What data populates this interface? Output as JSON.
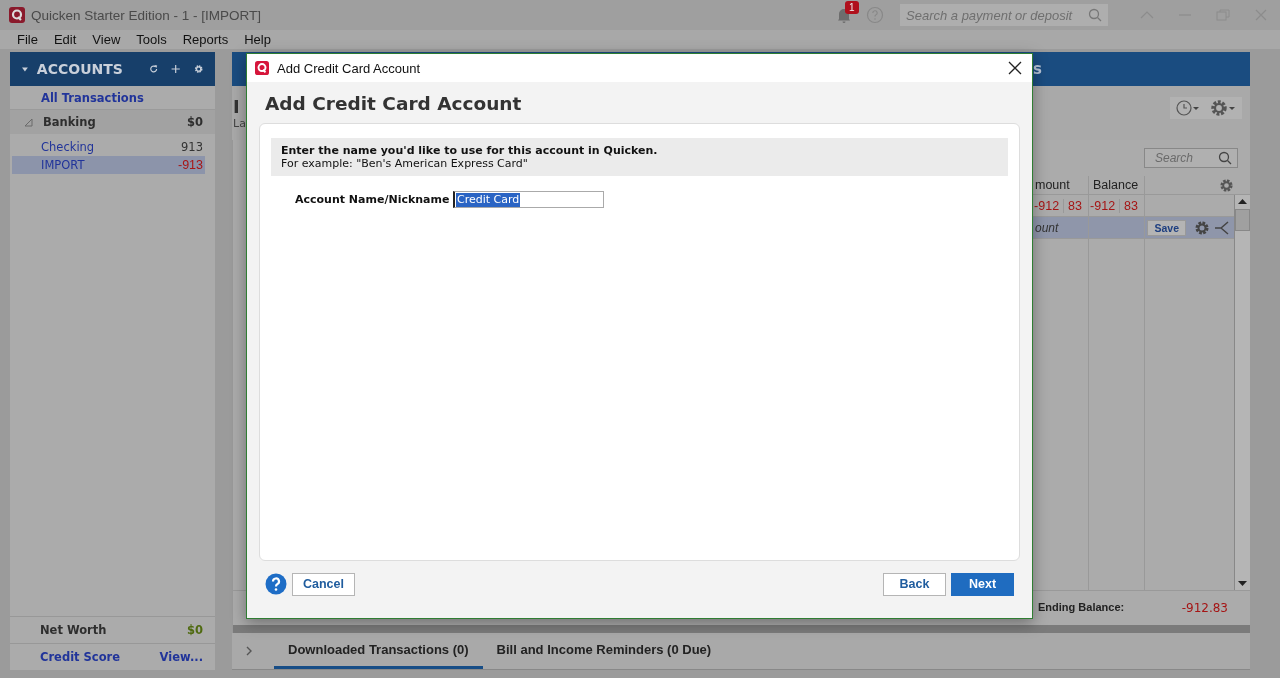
{
  "app": {
    "title": "Quicken Starter Edition - 1 - [IMPORT]",
    "notification_count": "1",
    "search": {
      "placeholder": "Search a payment or deposit"
    }
  },
  "menu": [
    "File",
    "Edit",
    "View",
    "Tools",
    "Reports",
    "Help"
  ],
  "sidebar": {
    "header": "ACCOUNTS",
    "all_transactions": "All Transactions",
    "groups": [
      {
        "label": "Banking",
        "amount": "$0",
        "expanded": true,
        "accounts": [
          {
            "name": "Checking",
            "amount": "913",
            "negative": false,
            "selected": false
          },
          {
            "name": "IMPORT",
            "amount": "-913",
            "negative": true,
            "selected": true
          }
        ]
      }
    ],
    "net_worth": {
      "label": "Net Worth",
      "amount": "$0"
    },
    "credit_score": {
      "label": "Credit Score",
      "link": "View..."
    }
  },
  "register": {
    "header_tail": "s",
    "heading": "I",
    "subtitle": "La",
    "search": {
      "placeholder": "Search"
    },
    "columns": [
      "mount",
      "Balance"
    ],
    "rows": [
      {
        "kind": "entry",
        "cells": [
          "-912",
          "83",
          "-912",
          "83"
        ],
        "selected": false
      },
      {
        "kind": "edit",
        "placeholder": "ount",
        "save": "Save",
        "selected": true
      }
    ],
    "ending_balance": {
      "label": "Ending Balance:",
      "value": "-912.83"
    },
    "tabs": [
      {
        "label": "Downloaded Transactions (0)",
        "selected": true
      },
      {
        "label": "Bill and Income Reminders (0 Due)",
        "selected": false
      }
    ]
  },
  "dialog": {
    "title": "Add Credit Card Account",
    "heading": "Add Credit Card Account",
    "instruction": "Enter the name you'd like to use for this account in Quicken.",
    "example": "For example: \"Ben's American Express Card\"",
    "field": {
      "label": "Account Name/Nickname",
      "value": "Credit Card"
    },
    "buttons": [
      {
        "label": "Cancel",
        "kind": "secondary"
      },
      {
        "label": "Back",
        "kind": "secondary"
      },
      {
        "label": "Next",
        "kind": "primary"
      }
    ]
  }
}
